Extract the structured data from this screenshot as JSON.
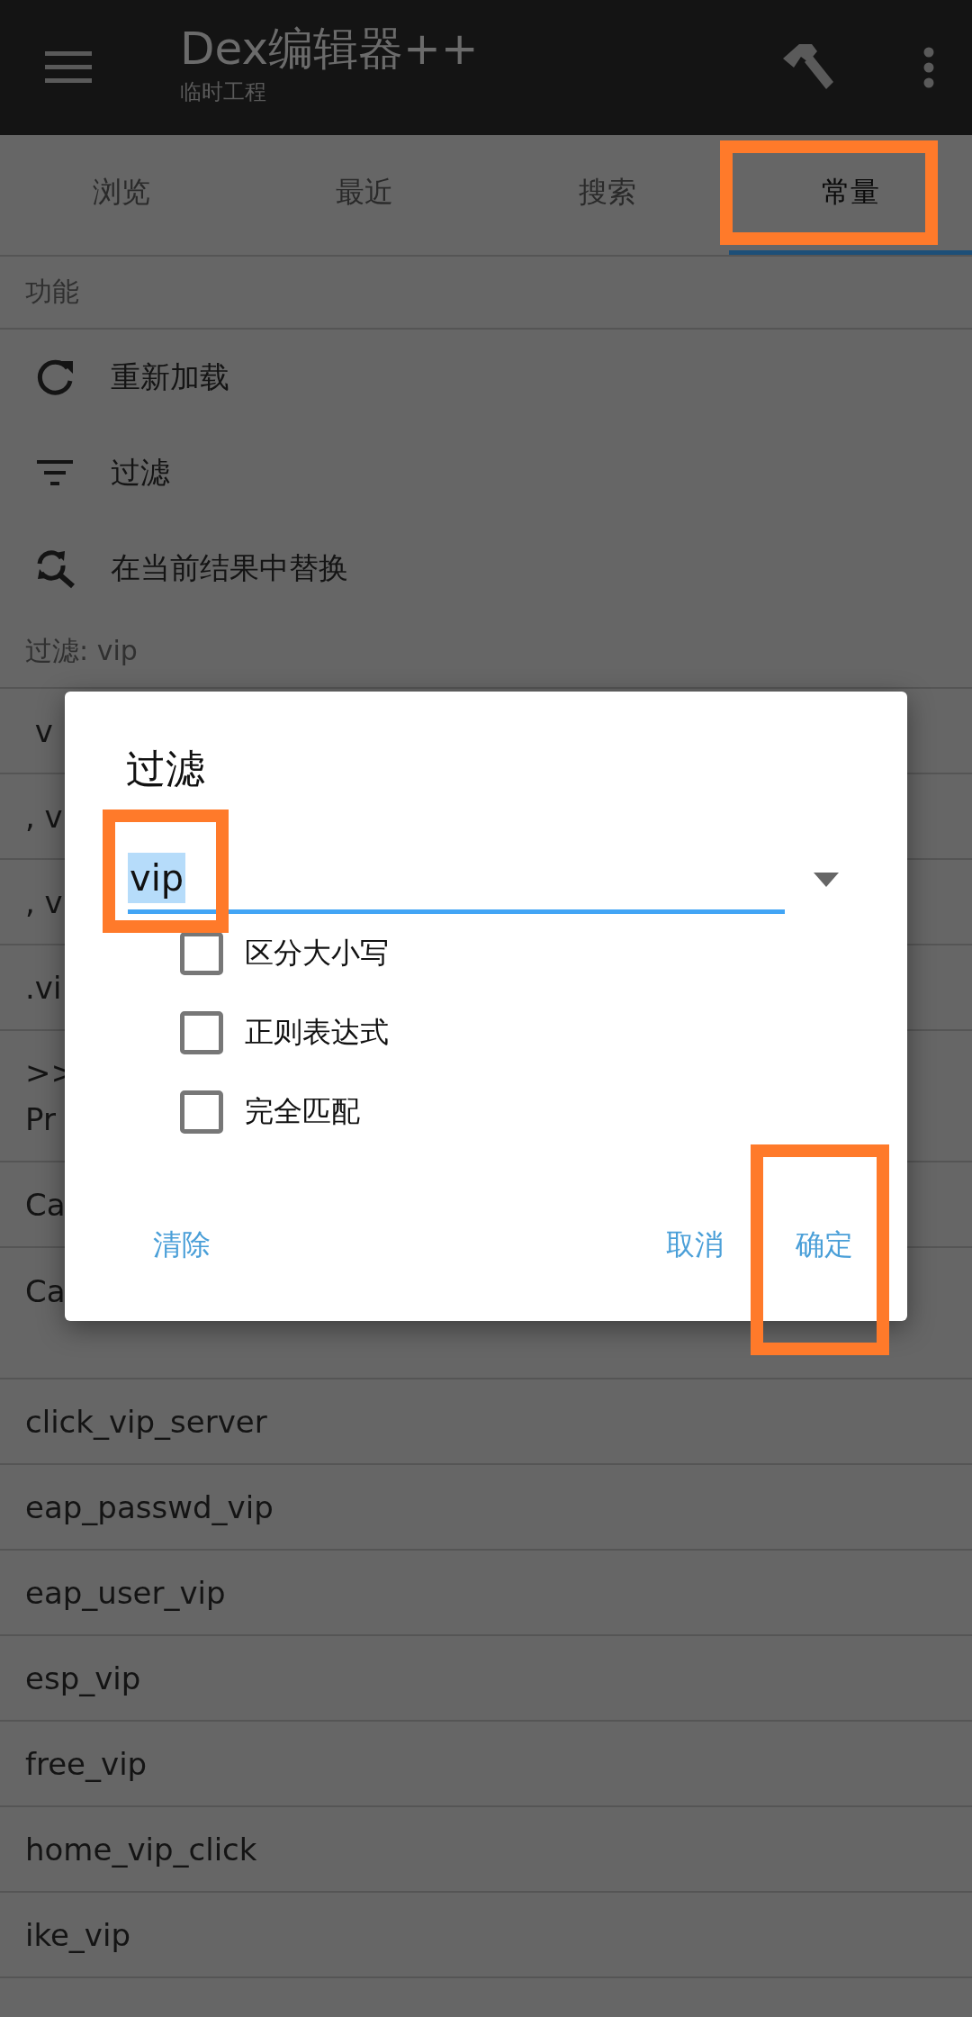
{
  "app_bar": {
    "title": "Dex编辑器++",
    "subtitle": "临时工程"
  },
  "tabs": [
    {
      "label": "浏览",
      "selected": false,
      "highlighted": false
    },
    {
      "label": "最近",
      "selected": false,
      "highlighted": false
    },
    {
      "label": "搜索",
      "selected": false,
      "highlighted": false
    },
    {
      "label": "常量",
      "selected": true,
      "highlighted": true
    }
  ],
  "functions": {
    "header": "功能",
    "items": [
      {
        "label": "重新加载",
        "kind": "reload"
      },
      {
        "label": "过滤",
        "kind": "filter"
      },
      {
        "label": "在当前结果中替换",
        "kind": "replace"
      }
    ]
  },
  "results": {
    "header": "过滤: vip",
    "rows": [
      {
        "lines": [
          " v"
        ],
        "tall": false
      },
      {
        "lines": [
          ", v"
        ],
        "tall": false
      },
      {
        "lines": [
          ", v"
        ],
        "tall": false
      },
      {
        "lines": [
          ".vi"
        ],
        "tall": false
      },
      {
        "lines": [
          ">>",
          "Pr"
        ],
        "tall": false
      },
      {
        "lines": [
          "Ca"
        ],
        "tall": false
      },
      {
        "lines": [
          "Ca"
        ],
        "tall": true
      },
      {
        "lines": [
          "click_vip_server"
        ],
        "tall": false
      },
      {
        "lines": [
          "eap_passwd_vip"
        ],
        "tall": false
      },
      {
        "lines": [
          "eap_user_vip"
        ],
        "tall": false
      },
      {
        "lines": [
          "esp_vip"
        ],
        "tall": false
      },
      {
        "lines": [
          "free_vip"
        ],
        "tall": false
      },
      {
        "lines": [
          "home_vip_click"
        ],
        "tall": false
      },
      {
        "lines": [
          "ike_vip"
        ],
        "tall": false
      }
    ]
  },
  "dialog": {
    "title": "过滤",
    "field": {
      "value": "vip",
      "text_selected": true,
      "highlighted": true
    },
    "options": [
      {
        "label": "区分大小写",
        "checked": false
      },
      {
        "label": "正则表达式",
        "checked": false
      },
      {
        "label": "完全匹配",
        "checked": false
      }
    ],
    "buttons_left": [
      {
        "label": "清除",
        "highlighted": false
      }
    ],
    "buttons_right": [
      {
        "label": "取消",
        "highlighted": false
      },
      {
        "label": "确定",
        "highlighted": true
      }
    ]
  }
}
